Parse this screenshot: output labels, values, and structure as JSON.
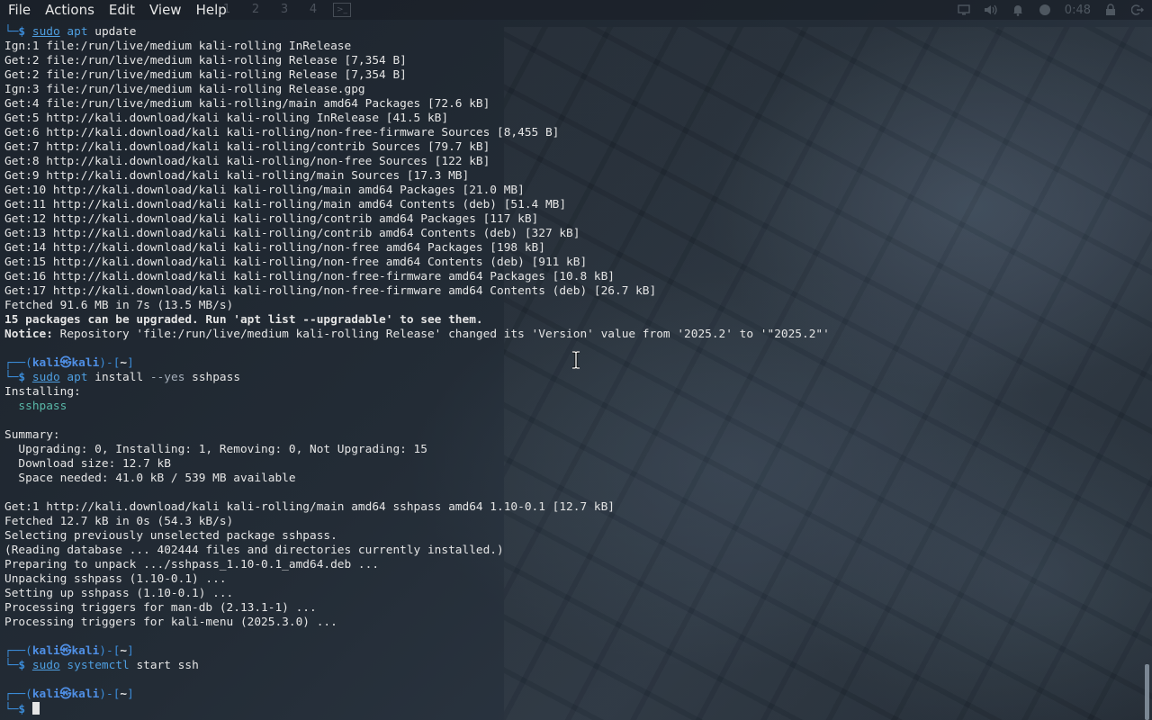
{
  "menubar": {
    "items": [
      "File",
      "Actions",
      "Edit",
      "View",
      "Help"
    ],
    "workspaces": [
      "1",
      "2",
      "3",
      "4"
    ],
    "clock": "0:48"
  },
  "prompt": {
    "user": "kali",
    "host": "kali",
    "dir": "~",
    "symbol": "$"
  },
  "lines": [
    {
      "kind": "cmd-tail",
      "sudo": "sudo",
      "bin": "apt",
      "args": " update"
    },
    {
      "kind": "text",
      "text": "Ign:1 file:/run/live/medium kali-rolling InRelease"
    },
    {
      "kind": "text",
      "text": "Get:2 file:/run/live/medium kali-rolling Release [7,354 B]"
    },
    {
      "kind": "text",
      "text": "Get:2 file:/run/live/medium kali-rolling Release [7,354 B]"
    },
    {
      "kind": "text",
      "text": "Ign:3 file:/run/live/medium kali-rolling Release.gpg"
    },
    {
      "kind": "text",
      "text": "Get:4 file:/run/live/medium kali-rolling/main amd64 Packages [72.6 kB]"
    },
    {
      "kind": "text",
      "text": "Get:5 http://kali.download/kali kali-rolling InRelease [41.5 kB]"
    },
    {
      "kind": "text",
      "text": "Get:6 http://kali.download/kali kali-rolling/non-free-firmware Sources [8,455 B]"
    },
    {
      "kind": "text",
      "text": "Get:7 http://kali.download/kali kali-rolling/contrib Sources [79.7 kB]"
    },
    {
      "kind": "text",
      "text": "Get:8 http://kali.download/kali kali-rolling/non-free Sources [122 kB]"
    },
    {
      "kind": "text",
      "text": "Get:9 http://kali.download/kali kali-rolling/main Sources [17.3 MB]"
    },
    {
      "kind": "text",
      "text": "Get:10 http://kali.download/kali kali-rolling/main amd64 Packages [21.0 MB]"
    },
    {
      "kind": "text",
      "text": "Get:11 http://kali.download/kali kali-rolling/main amd64 Contents (deb) [51.4 MB]"
    },
    {
      "kind": "text",
      "text": "Get:12 http://kali.download/kali kali-rolling/contrib amd64 Packages [117 kB]"
    },
    {
      "kind": "text",
      "text": "Get:13 http://kali.download/kali kali-rolling/contrib amd64 Contents (deb) [327 kB]"
    },
    {
      "kind": "text",
      "text": "Get:14 http://kali.download/kali kali-rolling/non-free amd64 Packages [198 kB]"
    },
    {
      "kind": "text",
      "text": "Get:15 http://kali.download/kali kali-rolling/non-free amd64 Contents (deb) [911 kB]"
    },
    {
      "kind": "text",
      "text": "Get:16 http://kali.download/kali kali-rolling/non-free-firmware amd64 Packages [10.8 kB]"
    },
    {
      "kind": "text",
      "text": "Get:17 http://kali.download/kali kali-rolling/non-free-firmware amd64 Contents (deb) [26.7 kB]"
    },
    {
      "kind": "text",
      "text": "Fetched 91.6 MB in 7s (13.5 MB/s)"
    },
    {
      "kind": "bold",
      "text": "15 packages can be upgraded. Run 'apt list --upgradable' to see them."
    },
    {
      "kind": "notice",
      "label": "Notice:",
      "text": " Repository 'file:/run/live/medium kali-rolling Release' changed its 'Version' value from '2025.2' to '\"2025.2\"'"
    },
    {
      "kind": "blank"
    },
    {
      "kind": "prompt-head"
    },
    {
      "kind": "cmd-tail",
      "sudo": "sudo",
      "bin": "apt",
      "args": " install ",
      "opt": "--yes",
      "args2": " sshpass"
    },
    {
      "kind": "text",
      "text": "Installing:"
    },
    {
      "kind": "pkg",
      "text": "  sshpass"
    },
    {
      "kind": "blank"
    },
    {
      "kind": "text",
      "text": "Summary:"
    },
    {
      "kind": "text",
      "text": "  Upgrading: 0, Installing: 1, Removing: 0, Not Upgrading: 15"
    },
    {
      "kind": "text",
      "text": "  Download size: 12.7 kB"
    },
    {
      "kind": "text",
      "text": "  Space needed: 41.0 kB / 539 MB available"
    },
    {
      "kind": "blank"
    },
    {
      "kind": "text",
      "text": "Get:1 http://kali.download/kali kali-rolling/main amd64 sshpass amd64 1.10-0.1 [12.7 kB]"
    },
    {
      "kind": "text",
      "text": "Fetched 12.7 kB in 0s (54.3 kB/s)"
    },
    {
      "kind": "text",
      "text": "Selecting previously unselected package sshpass."
    },
    {
      "kind": "text",
      "text": "(Reading database ... 402444 files and directories currently installed.)"
    },
    {
      "kind": "text",
      "text": "Preparing to unpack .../sshpass_1.10-0.1_amd64.deb ..."
    },
    {
      "kind": "text",
      "text": "Unpacking sshpass (1.10-0.1) ..."
    },
    {
      "kind": "text",
      "text": "Setting up sshpass (1.10-0.1) ..."
    },
    {
      "kind": "text",
      "text": "Processing triggers for man-db (2.13.1-1) ..."
    },
    {
      "kind": "text",
      "text": "Processing triggers for kali-menu (2025.3.0) ..."
    },
    {
      "kind": "blank"
    },
    {
      "kind": "prompt-head"
    },
    {
      "kind": "cmd-tail",
      "sudo": "sudo",
      "bin": "systemctl",
      "args": " start ssh"
    },
    {
      "kind": "blank"
    },
    {
      "kind": "prompt-head"
    },
    {
      "kind": "cursor-line"
    }
  ],
  "colors": {
    "prompt_frame": "#3b8cd8",
    "prompt_user": "#4f8fe5",
    "command": "#4e9ee0",
    "package": "#59b8a8",
    "text": "#e5e5e5"
  }
}
